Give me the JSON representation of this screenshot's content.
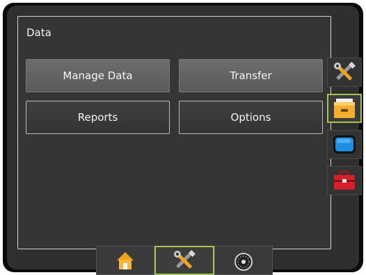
{
  "panel": {
    "title": "Data",
    "buttons": {
      "manage_data": "Manage Data",
      "transfer": "Transfer",
      "reports": "Reports",
      "options": "Options"
    }
  },
  "side_tabs": [
    {
      "icon": "tools-icon",
      "active": false
    },
    {
      "icon": "file-drawer-icon",
      "active": true
    },
    {
      "icon": "display-monitor-icon",
      "active": false
    },
    {
      "icon": "toolbox-icon",
      "active": false
    }
  ],
  "bottom_tabs": [
    {
      "icon": "home-icon",
      "active": false
    },
    {
      "icon": "tools-icon",
      "active": true
    },
    {
      "icon": "speedometer-icon",
      "active": false
    }
  ],
  "colors": {
    "accent_active_border": "#a9c44a",
    "button_fill": "#626262",
    "background": "#2f2f2f"
  }
}
